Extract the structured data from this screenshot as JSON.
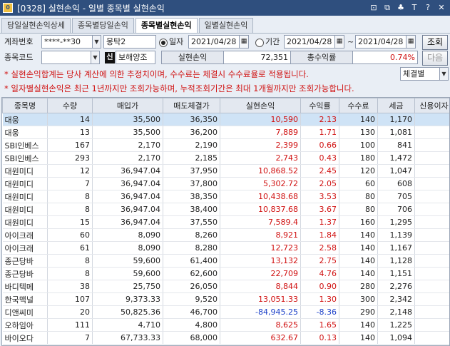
{
  "window": {
    "title": "[0328] 실현손익 - 일별 종목별 실현손익",
    "screen_code": "0",
    "buttons": [
      "⊡",
      "⧉",
      "♣",
      "T",
      "?",
      "✕"
    ]
  },
  "tabs": [
    {
      "label": "당일실현손익상세",
      "active": false
    },
    {
      "label": "종목별당일손익",
      "active": false
    },
    {
      "label": "종목별실현손익",
      "active": true
    },
    {
      "label": "일별실현손익",
      "active": false
    }
  ],
  "form": {
    "account_label": "계좌번호",
    "account_value": "****-**30",
    "account_name": "몽탁2",
    "radio_day_label": "일자",
    "day_date": "2021/04/28",
    "radio_period_label": "기간",
    "period_from": "2021/04/28",
    "period_sep": "~",
    "period_to": "2021/04/28",
    "query_button": "조회",
    "code_label": "종목코드",
    "code_value": "",
    "shin_badge": "신",
    "protect_label": "보해양조",
    "realized_label": "실현손익",
    "realized_value": "72,351",
    "return_label": "총수익률",
    "return_value": "0.74%",
    "next_button": "다음",
    "sort_select": "체결별",
    "notice1": "* 실현손익합계는 당사 계산에 의한 추정치이며, 수수료는 체결시 수수료율로 적용됩니다.",
    "notice2": "* 일자별실현손익은 최근 1년까지만 조회가능하며, 누적조회기간은 최대 1개월까지만 조회가능합니다."
  },
  "table": {
    "headers": [
      "종목명",
      "수량",
      "매입가",
      "매도체결가",
      "실현손익",
      "수익률",
      "수수료",
      "세금",
      "신용이자"
    ],
    "rows": [
      {
        "name": "대웅",
        "qty": "14",
        "buy": "35,500",
        "sell": "36,350",
        "pnl": "10,590",
        "rate": "2.13",
        "fee": "140",
        "tax": "1,170",
        "neg": false
      },
      {
        "name": "대웅",
        "qty": "13",
        "buy": "35,500",
        "sell": "36,200",
        "pnl": "7,889",
        "rate": "1.71",
        "fee": "130",
        "tax": "1,081",
        "neg": false
      },
      {
        "name": "SBI인베스",
        "qty": "167",
        "buy": "2,170",
        "sell": "2,190",
        "pnl": "2,399",
        "rate": "0.66",
        "fee": "100",
        "tax": "841",
        "neg": false
      },
      {
        "name": "SBI인베스",
        "qty": "293",
        "buy": "2,170",
        "sell": "2,185",
        "pnl": "2,743",
        "rate": "0.43",
        "fee": "180",
        "tax": "1,472",
        "neg": false
      },
      {
        "name": "대원미디",
        "qty": "12",
        "buy": "36,947.04",
        "sell": "37,950",
        "pnl": "10,868.52",
        "rate": "2.45",
        "fee": "120",
        "tax": "1,047",
        "neg": false
      },
      {
        "name": "대원미디",
        "qty": "7",
        "buy": "36,947.04",
        "sell": "37,800",
        "pnl": "5,302.72",
        "rate": "2.05",
        "fee": "60",
        "tax": "608",
        "neg": false
      },
      {
        "name": "대원미디",
        "qty": "8",
        "buy": "36,947.04",
        "sell": "38,350",
        "pnl": "10,438.68",
        "rate": "3.53",
        "fee": "80",
        "tax": "705",
        "neg": false
      },
      {
        "name": "대원미디",
        "qty": "8",
        "buy": "36,947.04",
        "sell": "38,400",
        "pnl": "10,837.68",
        "rate": "3.67",
        "fee": "80",
        "tax": "706",
        "neg": false
      },
      {
        "name": "대원미디",
        "qty": "15",
        "buy": "36,947.04",
        "sell": "37,550",
        "pnl": "7,589.4",
        "rate": "1.37",
        "fee": "160",
        "tax": "1,295",
        "neg": false
      },
      {
        "name": "아이크래",
        "qty": "60",
        "buy": "8,090",
        "sell": "8,260",
        "pnl": "8,921",
        "rate": "1.84",
        "fee": "140",
        "tax": "1,139",
        "neg": false
      },
      {
        "name": "아이크래",
        "qty": "61",
        "buy": "8,090",
        "sell": "8,280",
        "pnl": "12,723",
        "rate": "2.58",
        "fee": "140",
        "tax": "1,167",
        "neg": false
      },
      {
        "name": "종근당바",
        "qty": "8",
        "buy": "59,600",
        "sell": "61,400",
        "pnl": "13,132",
        "rate": "2.75",
        "fee": "140",
        "tax": "1,128",
        "neg": false
      },
      {
        "name": "종근당바",
        "qty": "8",
        "buy": "59,600",
        "sell": "62,600",
        "pnl": "22,709",
        "rate": "4.76",
        "fee": "140",
        "tax": "1,151",
        "neg": false
      },
      {
        "name": "바디텍메",
        "qty": "38",
        "buy": "25,750",
        "sell": "26,050",
        "pnl": "8,844",
        "rate": "0.90",
        "fee": "280",
        "tax": "2,276",
        "neg": false
      },
      {
        "name": "한국맥널",
        "qty": "107",
        "buy": "9,373.33",
        "sell": "9,520",
        "pnl": "13,051.33",
        "rate": "1.30",
        "fee": "300",
        "tax": "2,342",
        "neg": false
      },
      {
        "name": "디앤씨미",
        "qty": "20",
        "buy": "50,825.36",
        "sell": "46,700",
        "pnl": "-84,945.25",
        "rate": "-8.36",
        "fee": "290",
        "tax": "2,148",
        "neg": true
      },
      {
        "name": "오하임아",
        "qty": "111",
        "buy": "4,710",
        "sell": "4,800",
        "pnl": "8,625",
        "rate": "1.65",
        "fee": "140",
        "tax": "1,225",
        "neg": false
      },
      {
        "name": "바이오다",
        "qty": "7",
        "buy": "67,733.33",
        "sell": "68,000",
        "pnl": "632.67",
        "rate": "0.13",
        "fee": "140",
        "tax": "1,094",
        "neg": false
      }
    ]
  }
}
